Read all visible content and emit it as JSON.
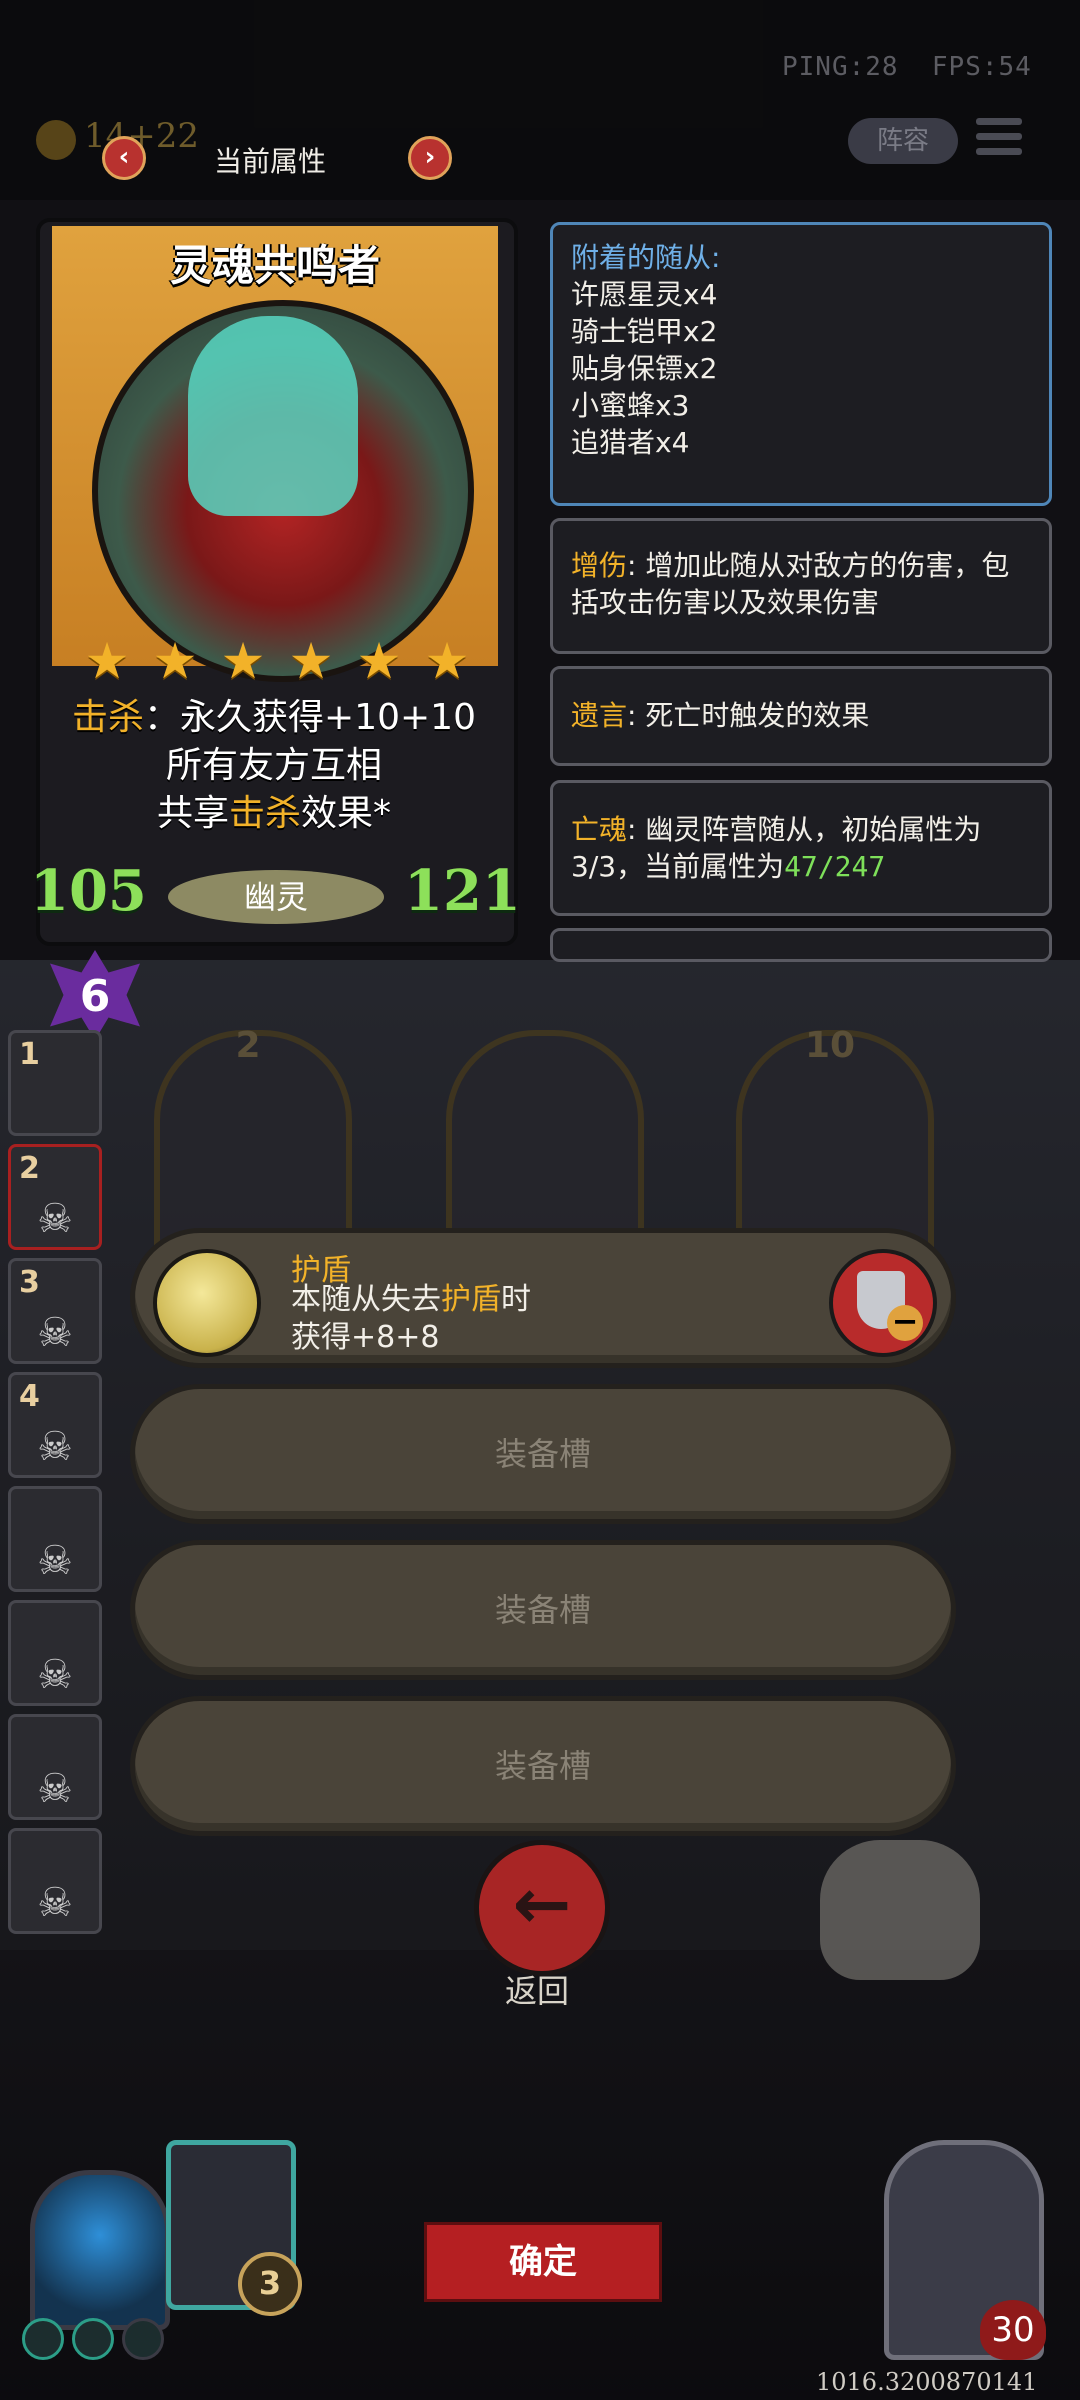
{
  "hud": {
    "ping": "PING:28",
    "fps": "FPS:54",
    "gold_value": "14",
    "gold_bonus": "+22",
    "lineup_label": "阵容"
  },
  "header": {
    "title": "当前属性",
    "prev_arrow": "‹",
    "next_arrow": "›"
  },
  "card": {
    "name": "灵魂共鸣者",
    "stars": 6,
    "ability_line1_keyword": "击杀",
    "ability_line1_rest": "：永久获得+10+10",
    "ability_line2": "所有友方互相",
    "ability_line3_prefix": "共享",
    "ability_line3_keyword": "击杀",
    "ability_line3_suffix": "效果*",
    "attack": "105",
    "health": "121",
    "tribe": "幽灵",
    "tier": "6"
  },
  "attached": {
    "title": "附着的随从:",
    "items": [
      "许愿星灵x4",
      "骑士铠甲x2",
      "贴身保镖x2",
      "小蜜蜂x3",
      "追猎者x4"
    ]
  },
  "keywords": [
    {
      "name": "增伤",
      "desc": ": 增加此随从对敌方的伤害，包括攻击伤害以及效果伤害"
    },
    {
      "name": "遗言",
      "desc": ": 死亡时触发的效果"
    },
    {
      "name": "亡魂",
      "desc": ": 幽灵阵营随从，初始属性为3/3，当前属性为",
      "value": "47/247"
    }
  ],
  "side_slots": [
    "1",
    "2",
    "3",
    "4",
    "",
    "",
    "",
    ""
  ],
  "board_minions": [
    "2",
    "",
    "10"
  ],
  "equipment": {
    "filled": {
      "name": "护盾",
      "desc_line1_prefix": "本随从失去",
      "desc_line1_keyword": "护盾",
      "desc_line1_suffix": "时",
      "desc_line2": "获得+8+8"
    },
    "empty_label": "装备槽",
    "empty_slots": 3
  },
  "back_label": "返回",
  "back_icon": "←",
  "confirm_label": "确定",
  "coin_counter": "3",
  "hero_hp": "30",
  "coords": "1016.3200870141",
  "colors": {
    "accent": "#f2b229",
    "stat_green": "#8de05a",
    "panel_border_blue": "#4f86b8",
    "button_red": "#b51f22"
  }
}
